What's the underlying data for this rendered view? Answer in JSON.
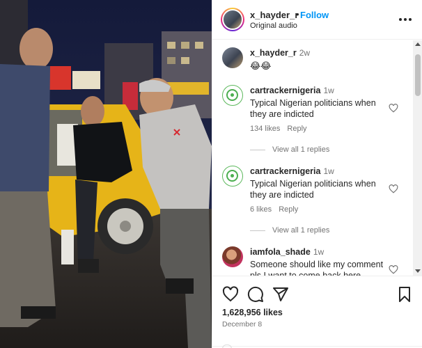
{
  "header": {
    "username": "x_hayder_r",
    "separator": "•",
    "follow_label": "Follow",
    "audio_label": "Original audio",
    "more_icon": "more-horizontal-icon"
  },
  "comments": [
    {
      "kind": "caption",
      "username": "x_hayder_r",
      "time": "2w",
      "text": "😂😂"
    },
    {
      "kind": "comment",
      "username": "cartrackernigeria",
      "time": "1w",
      "text": "Typical Nigerian politicians when they are indicted",
      "likes": "134 likes",
      "reply_label": "Reply",
      "view_replies": "View all 1 replies"
    },
    {
      "kind": "comment",
      "username": "cartrackernigeria",
      "time": "1w",
      "text": "Typical Nigerian politicians when they are indicted",
      "likes": "6 likes",
      "reply_label": "Reply",
      "view_replies": "View all 1 replies"
    },
    {
      "kind": "comment",
      "username": "iamfola_shade",
      "time": "1w",
      "text": "Someone should like my comment pls I want to come back here"
    }
  ],
  "actions": {
    "icons": [
      "heart-icon",
      "comment-icon",
      "share-icon",
      "bookmark-icon"
    ],
    "likes_count": "1,628,956 likes",
    "date": "December 8"
  },
  "media": {
    "description_icon": "video-frame"
  },
  "colors": {
    "accent": "#0095f6",
    "text": "#262626",
    "muted": "#737373",
    "divider": "#efefef"
  }
}
